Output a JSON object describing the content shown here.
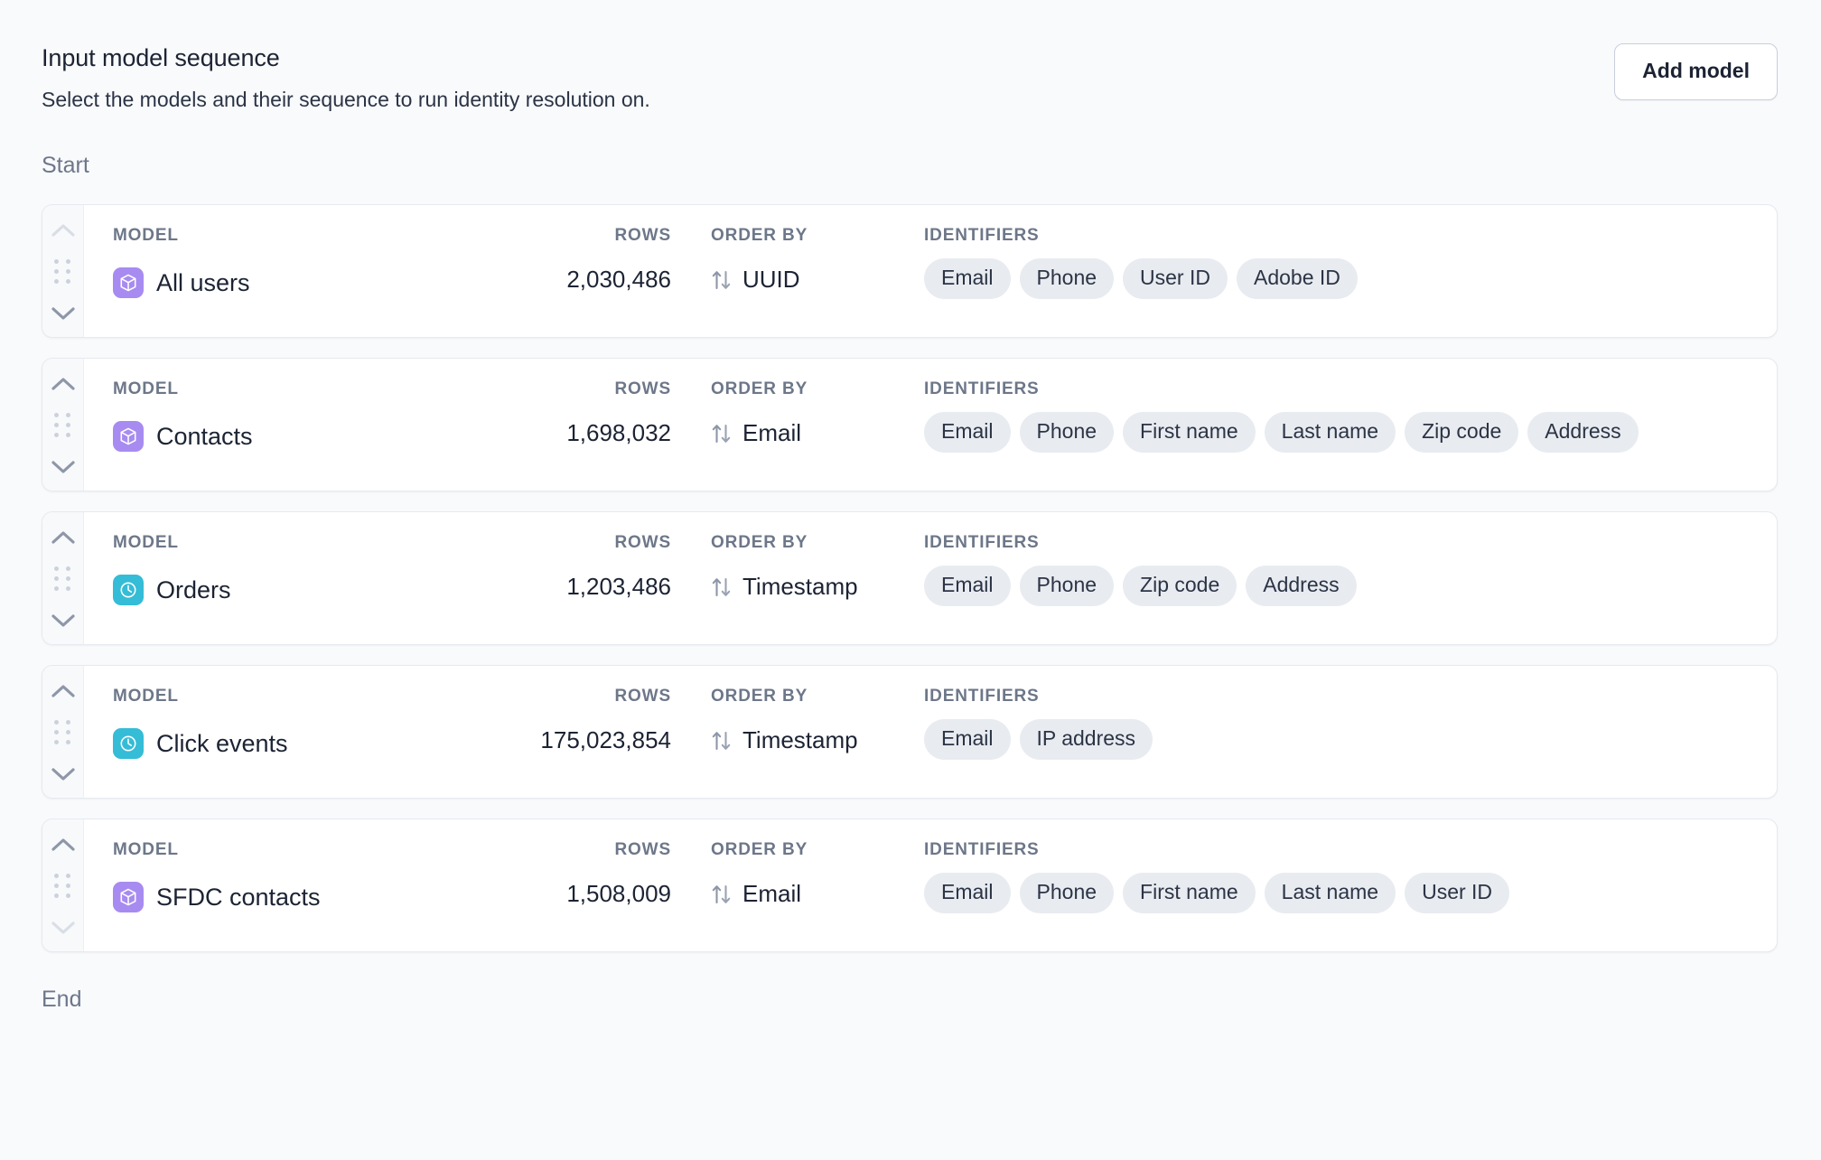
{
  "header": {
    "title": "Input model sequence",
    "subtitle": "Select the models and their sequence to run identity resolution on.",
    "add_model_label": "Add model"
  },
  "sequence": {
    "start_label": "Start",
    "end_label": "End"
  },
  "columns": {
    "model": "MODEL",
    "rows": "ROWS",
    "order_by": "ORDER BY",
    "identifiers": "IDENTIFIERS"
  },
  "colors": {
    "model_icon_purple": "#a78bf0",
    "model_icon_teal": "#35bcd6",
    "chip_bg": "#e8ebf0",
    "page_bg": "#f9fafc",
    "card_bg": "#ffffff",
    "handle_bg": "#f8f9fb",
    "label_gray": "#6d7789",
    "text_dark": "#1c2333",
    "chevron_active": "#8d97a8",
    "chevron_disabled": "#d9dee6"
  },
  "models": [
    {
      "name": "All users",
      "icon": "cube-icon",
      "icon_color": "#a78bf0",
      "rows": "2,030,486",
      "order_by": "UUID",
      "identifiers": [
        "Email",
        "Phone",
        "User ID",
        "Adobe ID"
      ],
      "move_up_enabled": false,
      "move_down_enabled": true
    },
    {
      "name": "Contacts",
      "icon": "cube-icon",
      "icon_color": "#a78bf0",
      "rows": "1,698,032",
      "order_by": "Email",
      "identifiers": [
        "Email",
        "Phone",
        "First name",
        "Last name",
        "Zip code",
        "Address"
      ],
      "move_up_enabled": true,
      "move_down_enabled": true
    },
    {
      "name": "Orders",
      "icon": "clock-icon",
      "icon_color": "#35bcd6",
      "rows": "1,203,486",
      "order_by": "Timestamp",
      "identifiers": [
        "Email",
        "Phone",
        "Zip code",
        "Address"
      ],
      "move_up_enabled": true,
      "move_down_enabled": true
    },
    {
      "name": "Click events",
      "icon": "clock-icon",
      "icon_color": "#35bcd6",
      "rows": "175,023,854",
      "order_by": "Timestamp",
      "identifiers": [
        "Email",
        "IP address"
      ],
      "move_up_enabled": true,
      "move_down_enabled": true
    },
    {
      "name": "SFDC contacts",
      "icon": "cube-icon",
      "icon_color": "#a78bf0",
      "rows": "1,508,009",
      "order_by": "Email",
      "identifiers": [
        "Email",
        "Phone",
        "First name",
        "Last name",
        "User ID"
      ],
      "move_up_enabled": true,
      "move_down_enabled": false
    }
  ]
}
